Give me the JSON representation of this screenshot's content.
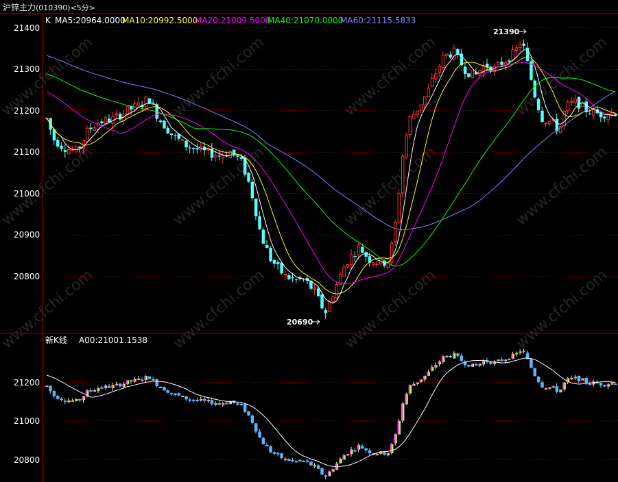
{
  "window": {
    "title_cn": "沪锌主力",
    "title_code": "(010390)",
    "title_period": "<5分>"
  },
  "top_panel": {
    "indicator_prefix": "K",
    "ma_labels": [
      {
        "text": "MA5:20964.0000",
        "color": "#ffffff"
      },
      {
        "text": "MA10:20992.5000",
        "color": "#ffff00"
      },
      {
        "text": "MA20:21009.5000",
        "color": "#ff00ff"
      },
      {
        "text": "MA40:21070.0000",
        "color": "#00ff00"
      },
      {
        "text": "MA60:21115.5833",
        "color": "#8080ff"
      }
    ],
    "y_ticks": [
      "21400",
      "21300",
      "21200",
      "21100",
      "21000",
      "20900",
      "20800"
    ],
    "high_label": "21390",
    "low_label": "20690"
  },
  "bottom_panel": {
    "indicator_name": "新K线",
    "indicator_value": "A00:21001.1538",
    "y_ticks": [
      "21200",
      "21000",
      "20800"
    ]
  },
  "watermark": "www.cfchi.com",
  "colors": {
    "up": "#ff3232",
    "down": "#54ffff",
    "grid": "#7a0000",
    "axis": "#b00000",
    "text": "#ffffff"
  }
}
